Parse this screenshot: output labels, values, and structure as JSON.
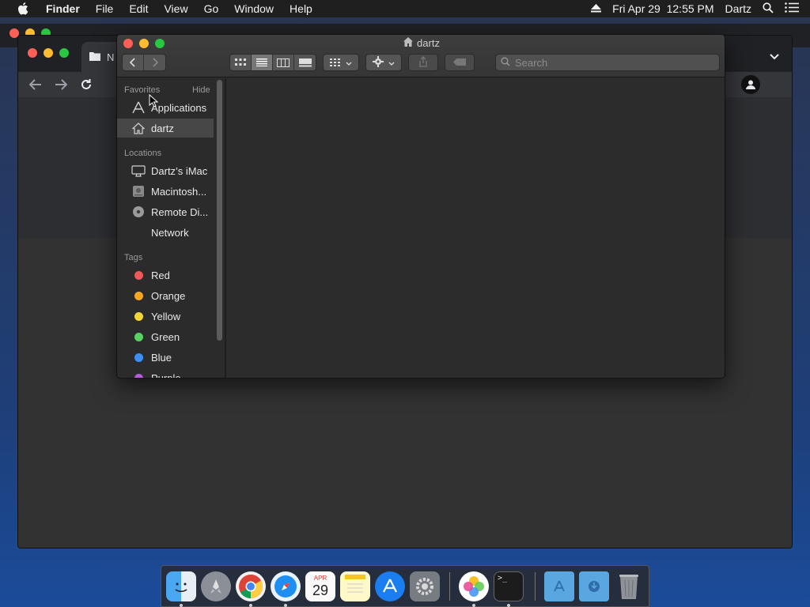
{
  "menubar": {
    "app_name": "Finder",
    "menus": [
      "File",
      "Edit",
      "View",
      "Go",
      "Window",
      "Help"
    ],
    "clock": "Fri Apr 29  12:55 PM",
    "user": "Dartz"
  },
  "chrome": {
    "tab_label": "N"
  },
  "finder": {
    "title": "dartz",
    "search_placeholder": "Search",
    "sidebar": {
      "favorites_header": "Favorites",
      "hide_label": "Hide",
      "favorites": [
        {
          "label": "Applications",
          "icon": "applications-icon"
        },
        {
          "label": "dartz",
          "icon": "home-icon",
          "selected": true
        }
      ],
      "locations_header": "Locations",
      "locations": [
        {
          "label": "Dartz’s iMac",
          "icon": "imac-icon"
        },
        {
          "label": "Macintosh...",
          "icon": "hard-disk-icon"
        },
        {
          "label": "Remote Di...",
          "icon": "disc-icon"
        },
        {
          "label": "Network",
          "icon": "network-icon"
        }
      ],
      "tags_header": "Tags",
      "tags": [
        {
          "label": "Red",
          "color": "#ee5a5a"
        },
        {
          "label": "Orange",
          "color": "#f5a623"
        },
        {
          "label": "Yellow",
          "color": "#f3d53a"
        },
        {
          "label": "Green",
          "color": "#57d163"
        },
        {
          "label": "Blue",
          "color": "#3d8ff5"
        },
        {
          "label": "Purple",
          "color": "#b25de0"
        }
      ]
    }
  },
  "dock": {
    "calendar_month": "APR",
    "calendar_day": "29",
    "apps": [
      "Finder",
      "Launchpad",
      "Google Chrome",
      "Safari",
      "Calendar",
      "Notes",
      "App Store",
      "System Preferences",
      "Photos",
      "Terminal",
      "Applications",
      "Downloads",
      "Trash"
    ]
  }
}
